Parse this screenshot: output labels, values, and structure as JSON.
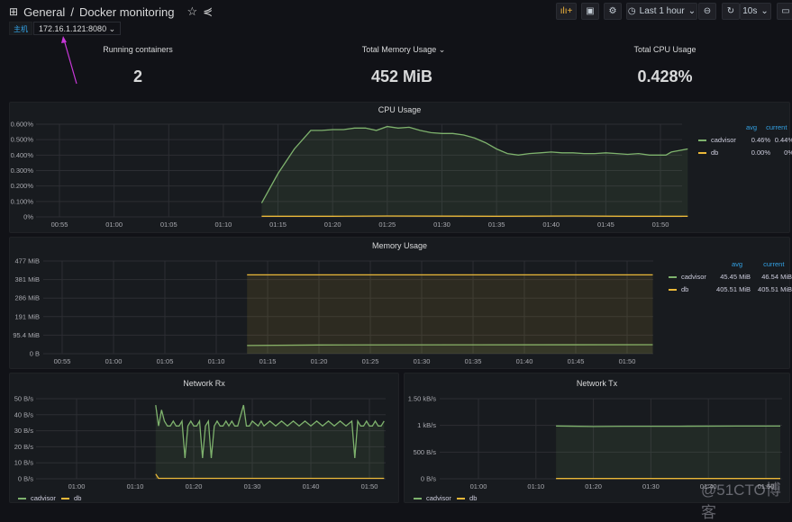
{
  "header": {
    "home_label": "General",
    "separator": "/",
    "title": "Docker monitoring",
    "toolbar": {
      "time_range": "Last 1 hour",
      "refresh_interval": "10s"
    }
  },
  "variables": {
    "label": "主机",
    "value": "172.16.1.121:8080"
  },
  "colors": {
    "cadvisor": "#7eb26d",
    "db": "#eab839",
    "accent": "#33a2e5",
    "annotation_arrow": "#c838d8"
  },
  "stats": [
    {
      "title": "Running containers",
      "value": "2"
    },
    {
      "title": "Total Memory Usage",
      "value": "452 MiB"
    },
    {
      "title": "Total CPU Usage",
      "value": "0.428%"
    }
  ],
  "chart_data": [
    {
      "id": "cpu",
      "type": "area",
      "title": "CPU Usage",
      "ylim": [
        0,
        0.6
      ],
      "yticks": [
        {
          "v": 0,
          "label": "0%"
        },
        {
          "v": 0.1,
          "label": "0.100%"
        },
        {
          "v": 0.2,
          "label": "0.200%"
        },
        {
          "v": 0.3,
          "label": "0.300%"
        },
        {
          "v": 0.4,
          "label": "0.400%"
        },
        {
          "v": 0.5,
          "label": "0.500%"
        },
        {
          "v": 0.6,
          "label": "0.600%"
        }
      ],
      "xticks": [
        "00:55",
        "01:00",
        "01:05",
        "01:10",
        "01:15",
        "01:20",
        "01:25",
        "01:30",
        "01:35",
        "01:40",
        "01:45",
        "01:50"
      ],
      "legend": {
        "columns": [
          "avg",
          "current"
        ],
        "rows": [
          {
            "name": "cadvisor",
            "avg": "0.46%",
            "current": "0.44%"
          },
          {
            "name": "db",
            "avg": "0.00%",
            "current": "0%"
          }
        ]
      },
      "series": [
        {
          "name": "cadvisor",
          "points": [
            [
              "01:13:30",
              0.09
            ],
            [
              "01:15:00",
              0.28
            ],
            [
              "01:16:30",
              0.44
            ],
            [
              "01:18:00",
              0.56
            ],
            [
              "01:19:00",
              0.56
            ],
            [
              "01:20:00",
              0.565
            ],
            [
              "01:21:00",
              0.565
            ],
            [
              "01:22:00",
              0.575
            ],
            [
              "01:23:00",
              0.575
            ],
            [
              "01:24:00",
              0.56
            ],
            [
              "01:25:00",
              0.585
            ],
            [
              "01:26:00",
              0.575
            ],
            [
              "01:27:00",
              0.58
            ],
            [
              "01:28:00",
              0.56
            ],
            [
              "01:29:00",
              0.545
            ],
            [
              "01:30:00",
              0.54
            ],
            [
              "01:31:00",
              0.54
            ],
            [
              "01:32:00",
              0.53
            ],
            [
              "01:33:00",
              0.51
            ],
            [
              "01:34:00",
              0.48
            ],
            [
              "01:35:00",
              0.44
            ],
            [
              "01:36:00",
              0.41
            ],
            [
              "01:37:00",
              0.4
            ],
            [
              "01:38:00",
              0.41
            ],
            [
              "01:39:00",
              0.415
            ],
            [
              "01:40:00",
              0.42
            ],
            [
              "01:41:00",
              0.415
            ],
            [
              "01:42:00",
              0.415
            ],
            [
              "01:43:00",
              0.41
            ],
            [
              "01:44:00",
              0.41
            ],
            [
              "01:45:00",
              0.415
            ],
            [
              "01:46:00",
              0.41
            ],
            [
              "01:47:00",
              0.405
            ],
            [
              "01:48:00",
              0.41
            ],
            [
              "01:49:00",
              0.4
            ],
            [
              "01:50:30",
              0.4
            ],
            [
              "01:51:00",
              0.42
            ],
            [
              "01:52:30",
              0.44
            ]
          ]
        },
        {
          "name": "db",
          "points": [
            [
              "01:13:30",
              0.004
            ],
            [
              "01:20:00",
              0.004
            ],
            [
              "01:25:00",
              0.006
            ],
            [
              "01:35:00",
              0.004
            ],
            [
              "01:42:00",
              0.006
            ],
            [
              "01:47:00",
              0.004
            ],
            [
              "01:52:30",
              0.004
            ]
          ]
        }
      ]
    },
    {
      "id": "memory",
      "type": "area",
      "title": "Memory Usage",
      "ylim": [
        0,
        476.8
      ],
      "yticks": [
        {
          "v": 0,
          "label": "0 B"
        },
        {
          "v": 95.4,
          "label": "95.4 MiB"
        },
        {
          "v": 190.7,
          "label": "191 MiB"
        },
        {
          "v": 286.1,
          "label": "286 MiB"
        },
        {
          "v": 381.5,
          "label": "381 MiB"
        },
        {
          "v": 476.8,
          "label": "477 MiB"
        }
      ],
      "xticks": [
        "00:55",
        "01:00",
        "01:05",
        "01:10",
        "01:15",
        "01:20",
        "01:25",
        "01:30",
        "01:35",
        "01:40",
        "01:45",
        "01:50"
      ],
      "legend": {
        "columns": [
          "avg",
          "current"
        ],
        "rows": [
          {
            "name": "cadvisor",
            "avg": "45.45 MiB",
            "current": "46.54 MiB"
          },
          {
            "name": "db",
            "avg": "405.51 MiB",
            "current": "405.51 MiB"
          }
        ]
      },
      "series": [
        {
          "name": "cadvisor",
          "points": [
            [
              "01:13:00",
              42
            ],
            [
              "01:20:00",
              45
            ],
            [
              "01:35:00",
              46
            ],
            [
              "01:52:30",
              46.5
            ]
          ]
        },
        {
          "name": "db",
          "points": [
            [
              "01:13:00",
              405.51
            ],
            [
              "01:52:30",
              405.51
            ]
          ]
        }
      ]
    },
    {
      "id": "rx",
      "type": "area",
      "title": "Network Rx",
      "ylim": [
        0,
        50
      ],
      "yticks": [
        {
          "v": 0,
          "label": "0 B/s"
        },
        {
          "v": 10,
          "label": "10 B/s"
        },
        {
          "v": 20,
          "label": "20 B/s"
        },
        {
          "v": 30,
          "label": "30 B/s"
        },
        {
          "v": 40,
          "label": "40 B/s"
        },
        {
          "v": 50,
          "label": "50 B/s"
        }
      ],
      "xticks": [
        "01:00",
        "01:10",
        "01:20",
        "01:30",
        "01:40",
        "01:50"
      ],
      "legend": {
        "columns": [],
        "rows": [
          {
            "name": "cadvisor"
          },
          {
            "name": "db"
          }
        ]
      },
      "series": [
        {
          "name": "cadvisor",
          "points": [
            [
              "01:13:30",
              46
            ],
            [
              "01:14:00",
              33
            ],
            [
              "01:14:30",
              43
            ],
            [
              "01:15:00",
              36
            ],
            [
              "01:15:30",
              33
            ],
            [
              "01:16:00",
              33
            ],
            [
              "01:16:30",
              36
            ],
            [
              "01:17:00",
              33
            ],
            [
              "01:17:30",
              33
            ],
            [
              "01:18:00",
              36
            ],
            [
              "01:18:30",
              13
            ],
            [
              "01:19:00",
              33
            ],
            [
              "01:19:30",
              36
            ],
            [
              "01:20:00",
              33
            ],
            [
              "01:20:30",
              33
            ],
            [
              "01:21:00",
              36
            ],
            [
              "01:21:30",
              13
            ],
            [
              "01:22:00",
              33
            ],
            [
              "01:22:30",
              36
            ],
            [
              "01:23:00",
              13
            ],
            [
              "01:23:30",
              33
            ],
            [
              "01:24:00",
              36
            ],
            [
              "01:24:30",
              33
            ],
            [
              "01:25:00",
              33
            ],
            [
              "01:25:30",
              36
            ],
            [
              "01:26:00",
              33
            ],
            [
              "01:26:30",
              36
            ],
            [
              "01:27:00",
              33
            ],
            [
              "01:27:30",
              33
            ],
            [
              "01:28:30",
              46
            ],
            [
              "01:29:00",
              33
            ],
            [
              "01:29:30",
              33
            ],
            [
              "01:30:00",
              36
            ],
            [
              "01:31:00",
              33
            ],
            [
              "01:31:30",
              36
            ],
            [
              "01:32:00",
              33
            ],
            [
              "01:33:00",
              36
            ],
            [
              "01:34:00",
              33
            ],
            [
              "01:35:00",
              36
            ],
            [
              "01:36:00",
              33
            ],
            [
              "01:37:00",
              36
            ],
            [
              "01:38:00",
              33
            ],
            [
              "01:39:00",
              36
            ],
            [
              "01:40:00",
              33
            ],
            [
              "01:41:00",
              36
            ],
            [
              "01:42:00",
              33
            ],
            [
              "01:43:00",
              36
            ],
            [
              "01:44:00",
              33
            ],
            [
              "01:45:00",
              36
            ],
            [
              "01:46:00",
              33
            ],
            [
              "01:47:00",
              36
            ],
            [
              "01:47:30",
              13
            ],
            [
              "01:48:00",
              36
            ],
            [
              "01:48:30",
              33
            ],
            [
              "01:49:00",
              33
            ],
            [
              "01:49:30",
              36
            ],
            [
              "01:50:00",
              33
            ],
            [
              "01:50:30",
              33
            ],
            [
              "01:51:00",
              36
            ],
            [
              "01:51:30",
              33
            ],
            [
              "01:52:00",
              33
            ],
            [
              "01:52:30",
              36
            ]
          ]
        },
        {
          "name": "db",
          "points": [
            [
              "01:13:30",
              3
            ],
            [
              "01:14:00",
              0.3
            ],
            [
              "01:52:30",
              0.3
            ]
          ]
        }
      ]
    },
    {
      "id": "tx",
      "type": "area",
      "title": "Network Tx",
      "ylim": [
        0,
        1500
      ],
      "yticks": [
        {
          "v": 0,
          "label": "0 B/s"
        },
        {
          "v": 500,
          "label": "500 B/s"
        },
        {
          "v": 1000,
          "label": "1 kB/s"
        },
        {
          "v": 1500,
          "label": "1.50 kB/s"
        }
      ],
      "xticks": [
        "01:00",
        "01:10",
        "01:20",
        "01:30",
        "01:40",
        "01:50"
      ],
      "legend": {
        "columns": [],
        "rows": [
          {
            "name": "cadvisor"
          },
          {
            "name": "db"
          }
        ]
      },
      "series": [
        {
          "name": "cadvisor",
          "points": [
            [
              "01:13:30",
              990
            ],
            [
              "01:20:00",
              980
            ],
            [
              "01:25:00",
              985
            ],
            [
              "01:35:00",
              985
            ],
            [
              "01:45:00",
              988
            ],
            [
              "01:52:30",
              988
            ]
          ]
        },
        {
          "name": "db",
          "points": [
            [
              "01:13:30",
              5
            ],
            [
              "01:52:30",
              5
            ]
          ]
        }
      ]
    }
  ],
  "watermark": "@51CTO博客"
}
